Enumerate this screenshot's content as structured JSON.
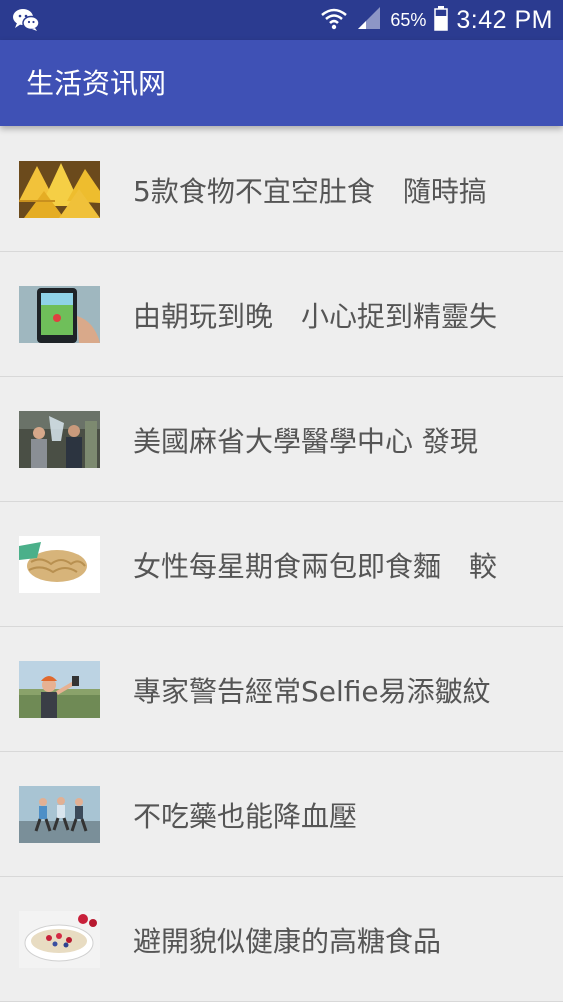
{
  "status_bar": {
    "battery": "65%",
    "time": "3:42 PM",
    "icons": [
      "wechat-icon",
      "wifi-icon",
      "signal-icon",
      "battery-icon"
    ]
  },
  "app_bar": {
    "title": "生活资讯网"
  },
  "articles": [
    {
      "title": "5款食物不宜空肚食　隨時搞",
      "thumbnail": "pineapple-thumbnail"
    },
    {
      "title": "由朝玩到晚　小心捉到精靈失",
      "thumbnail": "phone-game-thumbnail"
    },
    {
      "title": "美國麻省大學醫學中心  發現",
      "thumbnail": "ice-bucket-thumbnail"
    },
    {
      "title": "女性每星期食兩包即食麵　較",
      "thumbnail": "instant-noodles-thumbnail"
    },
    {
      "title": "專家警告經常Selfie易添皺紋",
      "thumbnail": "selfie-thumbnail"
    },
    {
      "title": "不吃藥也能降血壓",
      "thumbnail": "running-thumbnail"
    },
    {
      "title": "避開貌似健康的高糖食品",
      "thumbnail": "cereal-bowl-thumbnail"
    }
  ],
  "colors": {
    "status_bar": "#2b3b90",
    "app_bar": "#3f51b5",
    "background": "#eeeeee",
    "text": "#555555"
  }
}
